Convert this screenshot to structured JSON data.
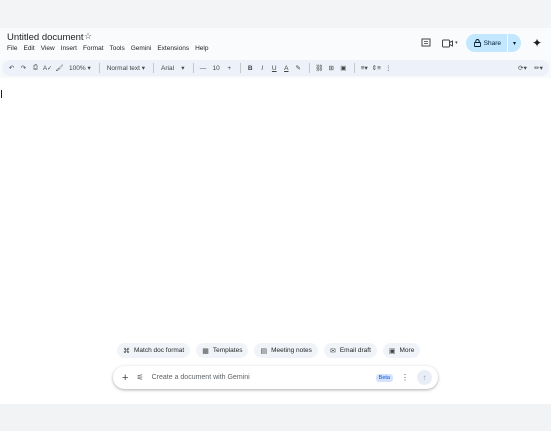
{
  "document": {
    "title": "Untitled document"
  },
  "menu": [
    "File",
    "Edit",
    "View",
    "Insert",
    "Format",
    "Tools",
    "Gemini",
    "Extensions",
    "Help"
  ],
  "header": {
    "share_label": "Share"
  },
  "toolbar": {
    "zoom": "100%",
    "style": "Normal text",
    "font": "Arial",
    "font_size": "10",
    "minus": "—",
    "plus": "+"
  },
  "gemini": {
    "chips": [
      {
        "label": "Match doc format",
        "icon": "format-match-icon"
      },
      {
        "label": "Templates",
        "icon": "templates-icon"
      },
      {
        "label": "Meeting notes",
        "icon": "meeting-notes-icon"
      },
      {
        "label": "Email draft",
        "icon": "email-icon"
      },
      {
        "label": "More",
        "icon": "more-icon"
      }
    ],
    "placeholder": "Create a document with Gemini",
    "beta_label": "Beta"
  },
  "colors": {
    "share_bg": "#c2e7ff",
    "toolbar_bg": "#edf2fa",
    "accent": "#0b57d0"
  }
}
